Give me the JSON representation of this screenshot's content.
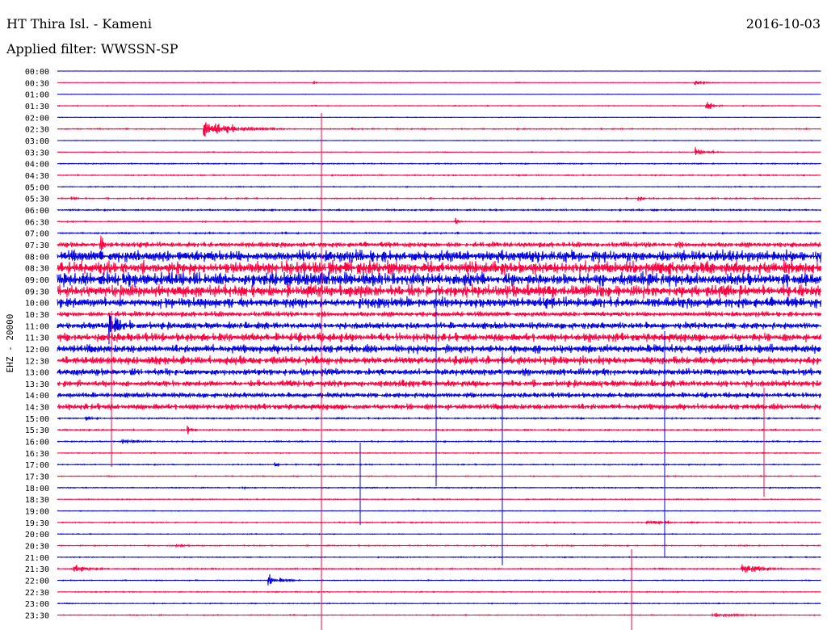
{
  "header": {
    "station": "HT Thira Isl. - Kameni",
    "date": "2016-10-03",
    "filter": "Applied filter: WWSSN-SP"
  },
  "chart_data": {
    "type": "line",
    "title": "HT Thira Isl. - Kameni",
    "ylabel": "EHZ - 20000",
    "x": [
      "00:00",
      "00:30",
      "01:00",
      "01:30",
      "02:00",
      "02:30",
      "03:00",
      "03:30",
      "04:00",
      "04:30",
      "05:00",
      "05:30",
      "06:00",
      "06:30",
      "07:00",
      "07:30",
      "08:00",
      "08:30",
      "09:00",
      "09:30",
      "10:00",
      "10:30",
      "11:00",
      "11:30",
      "12:00",
      "12:30",
      "13:00",
      "13:30",
      "14:00",
      "14:30",
      "15:00",
      "15:30",
      "16:00",
      "16:30",
      "17:00",
      "17:30",
      "18:00",
      "18:30",
      "19:00",
      "19:30",
      "20:00",
      "20:30",
      "21:00",
      "21:30",
      "22:00",
      "22:30",
      "23:00",
      "23:30"
    ],
    "trace_colors": [
      "#0000e0",
      "#ff0040"
    ],
    "series": [
      {
        "values": [
          0.2,
          0.3,
          0.2,
          0.4,
          0.3,
          0.6,
          0.3,
          0.4,
          0.6,
          0.6,
          0.5,
          0.7,
          0.8,
          0.6,
          0.8,
          3,
          7,
          8,
          8,
          7.5,
          6,
          3,
          4,
          5,
          5,
          5,
          4,
          4,
          3,
          3.5,
          0.8,
          0.8,
          0.7,
          0.5,
          0.6,
          0.5,
          0.5,
          0.5,
          0.4,
          0.6,
          0.4,
          0.6,
          0.5,
          0.7,
          0.5,
          0.5,
          0.5,
          0.5
        ]
      }
    ]
  }
}
